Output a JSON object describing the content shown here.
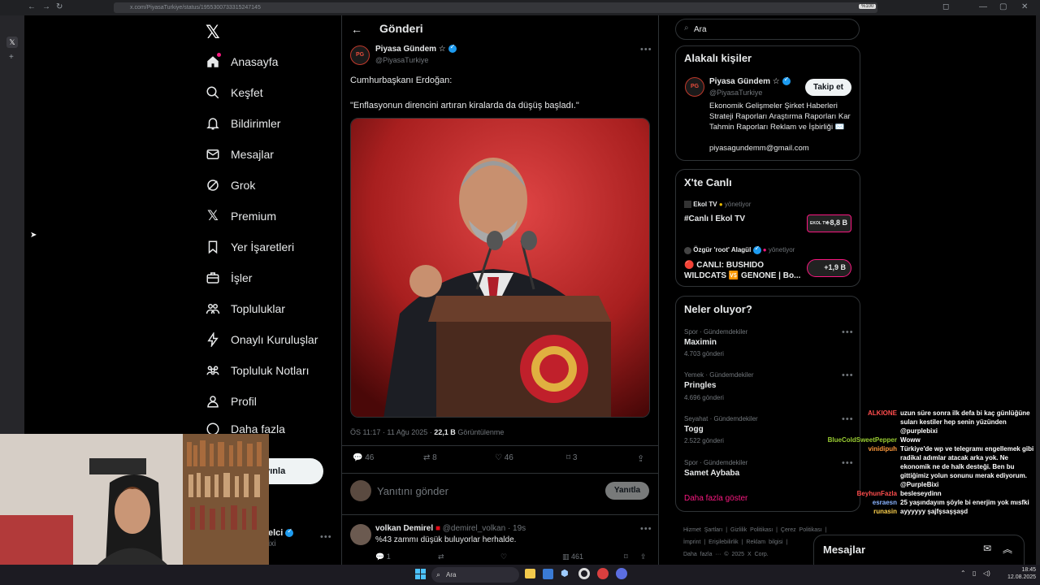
{
  "browser": {
    "url": "x.com/PiyasaTurkiye/status/1955300733315247145",
    "zoom": "%100"
  },
  "sidebar": {
    "items": [
      {
        "label": "Anasayfa",
        "icon": "home-icon"
      },
      {
        "label": "Keşfet",
        "icon": "search-icon"
      },
      {
        "label": "Bildirimler",
        "icon": "bell-icon"
      },
      {
        "label": "Mesajlar",
        "icon": "mail-icon"
      },
      {
        "label": "Grok",
        "icon": "grok-icon"
      },
      {
        "label": "Premium",
        "icon": "x-logo-icon"
      },
      {
        "label": "Yer İşaretleri",
        "icon": "bookmark-icon"
      },
      {
        "label": "İşler",
        "icon": "briefcase-icon"
      },
      {
        "label": "Topluluklar",
        "icon": "communities-icon"
      },
      {
        "label": "Onaylı Kuruluşlar",
        "icon": "lightning-icon"
      },
      {
        "label": "Topluluk Notları",
        "icon": "notes-icon"
      },
      {
        "label": "Profil",
        "icon": "person-icon"
      },
      {
        "label": "Daha fazla",
        "icon": "more-circle-icon"
      }
    ],
    "post_button": "ayınla",
    "account_name": "elci",
    "account_handle": "ixi"
  },
  "header": {
    "title": "Gönderi"
  },
  "post": {
    "avatar_text": "PG",
    "author": "Piyasa Gündem ☆",
    "handle": "@PiyasaTurkiye",
    "line1": "Cumhurbaşkanı Erdoğan:",
    "line2": "\"Enflasyonun direncini artıran kiralarda da düşüş başladı.\"",
    "time": "ÖS 11:17 · 11 Ağu 2025 ·",
    "views": "22,1 B",
    "views_label": "Görüntülenme",
    "replies": "46",
    "reposts": "8",
    "likes": "46",
    "bookmarks": "3"
  },
  "reply_box": {
    "placeholder": "Yanıtını gönder",
    "button": "Yanıtla"
  },
  "reply": {
    "author": "volkan Demirel",
    "handle": "@demirel_volkan · 19s",
    "text": "%43 zammı düşük buluyorlar herhalde.",
    "replies": "1",
    "views": "461"
  },
  "search": {
    "placeholder": "Ara"
  },
  "related": {
    "title": "Alakalı kişiler",
    "name": "Piyasa Gündem ☆",
    "handle": "@PiyasaTurkiye",
    "follow": "Takip et",
    "bio": "Ekonomik Gelişmeler Şirket Haberleri Strateji Raporları Araştırma Raporları Kar Tahmin Raporları Reklam ve İşbirliği ✉️",
    "email": "piyasagundemm@gmail.com"
  },
  "live": {
    "title": "X'te Canlı",
    "items": [
      {
        "host": "Ekol TV",
        "role": "yönetiyor",
        "title": "#Canlı l Ekol TV",
        "count": "+8,8 B",
        "thumb": "EKOL TV"
      },
      {
        "host": "Özgür 'root' Alagül",
        "role": "yönetiyor",
        "title": "🔴 CANLI: BUSHIDO WILDCATS 🆚 GENONE | Bo...",
        "count": "+1,9 B",
        "thumb": ""
      }
    ]
  },
  "trends": {
    "title": "Neler oluyor?",
    "items": [
      {
        "category": "Spor · Gündemdekiler",
        "name": "Maximin",
        "count": "4.703 gönderi"
      },
      {
        "category": "Yemek · Gündemdekiler",
        "name": "Pringles",
        "count": "4.696 gönderi"
      },
      {
        "category": "Seyahat · Gündemdekiler",
        "name": "Togg",
        "count": "2.522 gönderi"
      },
      {
        "category": "Spor · Gündemdekiler",
        "name": "Samet Aybaba",
        "count": ""
      }
    ],
    "more": "Daha fazla göster"
  },
  "footer": {
    "links": [
      "Hizmet Şartları",
      "Gizlilik Politikası",
      "Çerez Politikası",
      "İmprint",
      "Erişilebilirlik",
      "Reklam bilgisi"
    ],
    "more": "Daha fazla ···",
    "copyright": "© 2025 X Corp."
  },
  "messages_drawer": {
    "label": "Mesajlar"
  },
  "chat": [
    {
      "user": "ALKIONE",
      "color": "#ff4d4d",
      "text": "uzun süre sonra ilk defa bi kaç günlüğüne suları kestiler hep senin yüzünden @purplebixi"
    },
    {
      "user": "BlueColdSweetPepper",
      "color": "#9acd32",
      "text": "Woww"
    },
    {
      "user": "vinidipuh",
      "color": "#ff9a3c",
      "text": "Türkiye'de wp ve telegramı engellemek gibi radikal adımlar atacak arka yok. Ne ekonomik ne de halk desteği. Ben bu gittiğimiz yolun sonunu merak ediyorum. @PurpleBixi"
    },
    {
      "user": "BeyhunFazla",
      "color": "#ff4d4d",
      "text": "besleseydinn"
    },
    {
      "user": "esraesn",
      "color": "#8ab4ff",
      "text": "25 yaşındayım şöyle bi enerjim yok mısfki"
    },
    {
      "user": "runasin",
      "color": "#ffd24d",
      "text": "ayyyyyy şajfşsaşşaşd"
    }
  ],
  "taskbar": {
    "search": "Ara",
    "time": "18:45",
    "date": "12.08.2025"
  }
}
